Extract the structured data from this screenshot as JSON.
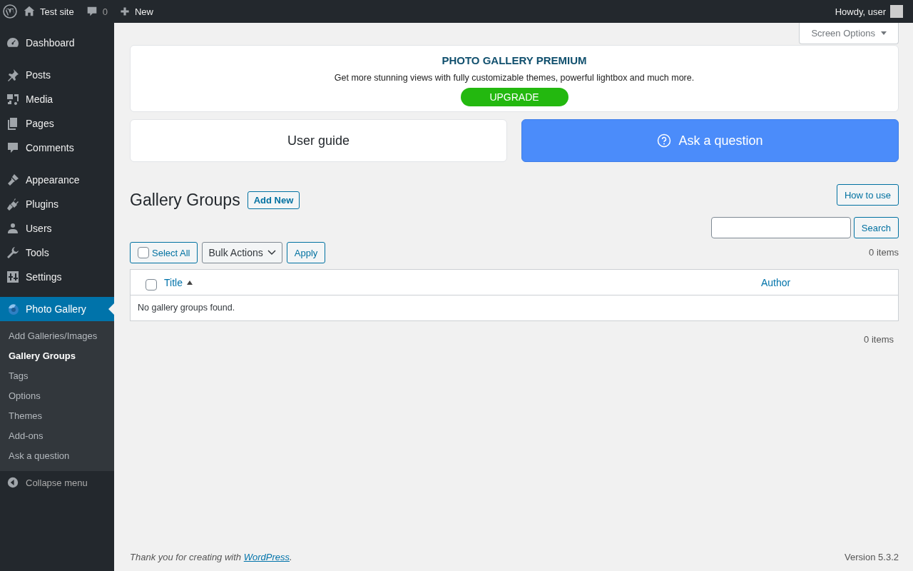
{
  "admin_bar": {
    "site_name": "Test site",
    "comments_count": "0",
    "new_label": "New",
    "greeting": "Howdy, user"
  },
  "sidebar": {
    "groups": [
      {
        "items": [
          {
            "label": "Dashboard",
            "selected": false
          }
        ]
      },
      {
        "items": [
          {
            "label": "Posts",
            "selected": false
          },
          {
            "label": "Media",
            "selected": false
          },
          {
            "label": "Pages",
            "selected": false
          },
          {
            "label": "Comments",
            "selected": false
          }
        ]
      },
      {
        "items": [
          {
            "label": "Appearance",
            "selected": false
          },
          {
            "label": "Plugins",
            "selected": false
          },
          {
            "label": "Users",
            "selected": false
          },
          {
            "label": "Tools",
            "selected": false
          },
          {
            "label": "Settings",
            "selected": false
          }
        ]
      },
      {
        "items": [
          {
            "label": "Photo Gallery",
            "selected": true
          }
        ]
      }
    ],
    "submenu": [
      {
        "label": "Add Galleries/Images",
        "selected": false
      },
      {
        "label": "Gallery Groups",
        "selected": true
      },
      {
        "label": "Tags",
        "selected": false
      },
      {
        "label": "Options",
        "selected": false
      },
      {
        "label": "Themes",
        "selected": false
      },
      {
        "label": "Add-ons",
        "selected": false
      },
      {
        "label": "Ask a question",
        "selected": false
      }
    ],
    "collapse_label": "Collapse menu"
  },
  "screen_options": "Screen Options",
  "premium_banner": {
    "title": "PHOTO GALLERY PREMIUM",
    "text": "Get more stunning views with fully customizable themes, powerful lightbox and much more.",
    "button": "UPGRADE"
  },
  "help_links": {
    "user_guide": "User guide",
    "ask_question": "Ask a question"
  },
  "page_title": "Gallery Groups",
  "add_new": "Add New",
  "how_to_use": "How to use",
  "search_button": "Search",
  "toolbar": {
    "select_all": {
      "label": "Select All",
      "checked": false
    },
    "bulk_actions": "Bulk Actions",
    "apply": "Apply",
    "items_count": "0 items"
  },
  "table": {
    "header_checked": false,
    "columns": [
      {
        "label": "Title",
        "sorted": true
      },
      {
        "label": "Author",
        "sorted": false
      }
    ],
    "empty_message": "No gallery groups found."
  },
  "bottom_items_count": "0 items",
  "footer": {
    "text_before": "Thank you for creating with ",
    "link": "WordPress",
    "text_after": ".",
    "version": "Version 5.3.2"
  }
}
